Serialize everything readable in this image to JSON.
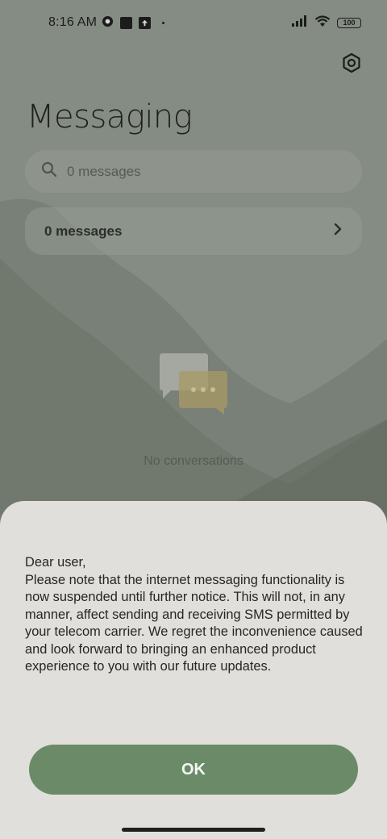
{
  "status_bar": {
    "time": "8:16 AM",
    "battery": "100"
  },
  "header": {
    "title": "Messaging"
  },
  "search": {
    "placeholder": "0 messages"
  },
  "messages_row": {
    "label": "0 messages"
  },
  "empty_state": {
    "text": "No conversations"
  },
  "dialog": {
    "message": "Dear user,\nPlease note that the internet messaging functionality is now suspended until further notice. This will not, in any manner, affect sending and receiving SMS permitted by your telecom carrier. We regret the inconvenience caused and look forward to bringing an enhanced product experience to you with our future updates.",
    "ok_label": "OK"
  },
  "colors": {
    "accent": "#6b8b68",
    "sheet_bg": "#e0dfdb",
    "scrim": "#7d857c"
  },
  "icons": [
    "search-icon",
    "settings-icon",
    "chevron-right-icon",
    "wifi-icon",
    "signal-icon",
    "battery-icon"
  ]
}
